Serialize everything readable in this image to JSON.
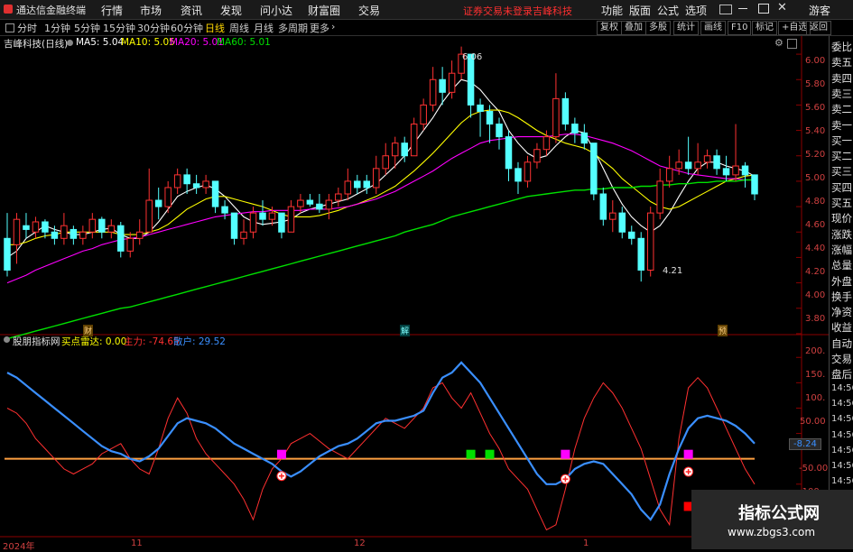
{
  "menubar": {
    "app_title": "通达信金融终端",
    "items": [
      "行情",
      "市场",
      "资讯",
      "发现",
      "问小达",
      "财富圈",
      "交易"
    ],
    "warning": "证券交易未登录",
    "stock_name": "吉峰科技",
    "right_items": [
      "功能",
      "版面",
      "公式",
      "选项"
    ],
    "guest": "游客"
  },
  "periodbar": {
    "tabs": [
      "分时",
      "1分钟",
      "5分钟",
      "15分钟",
      "30分钟",
      "60分钟",
      "日线",
      "周线",
      "月线",
      "多周期",
      "更多"
    ],
    "active": "日线",
    "buttons": [
      "复权",
      "叠加",
      "多股",
      "统计",
      "画线",
      "F10",
      "标记",
      "+自选",
      "返回"
    ]
  },
  "chart_header": {
    "stock": "吉峰科技(日线)",
    "ma5": "MA5: 5.04",
    "ma10": "MA10: 5.05",
    "ma20": "MA20: 5.01",
    "ma60": "MA60: 5.01"
  },
  "indicator_header": {
    "name": "股朋指标网",
    "buy": "买点雷达: 0.00",
    "main": "主力: -74.65",
    "retail": "散户: 29.52"
  },
  "right_panel": [
    "委比",
    "卖五",
    "卖四",
    "卖三",
    "卖二",
    "卖一",
    "买一",
    "买二",
    "买三",
    "买四",
    "买五",
    "现价",
    "涨跌",
    "涨幅",
    "总量",
    "外盘",
    "换手",
    "净资",
    "收益",
    "自动",
    "交易",
    "盘后",
    "14:56",
    "14:56",
    "14:56",
    "14:56",
    "14:56",
    "14:56",
    "14:56"
  ],
  "price_ticks": [
    "6.00",
    "5.80",
    "5.60",
    "5.40",
    "5.20",
    "5.00",
    "4.80",
    "4.60",
    "4.40",
    "4.20",
    "4.00",
    "3.80"
  ],
  "ind_ticks": [
    "200.",
    "150.",
    "100.",
    "50.00",
    "-50.00",
    "-100."
  ],
  "ind_current": "-8.24",
  "price_annotations": {
    "high": "6.06",
    "low": "4.21"
  },
  "markers": {
    "cai": "财",
    "jie": "解",
    "yu": "预"
  },
  "time_axis": [
    "2024年",
    "11",
    "12",
    "1"
  ],
  "watermark": {
    "line1": "指标公式网",
    "line2": "www.zbgs3.com"
  },
  "colors": {
    "up": "#ff3232",
    "down": "#54ffff",
    "ma5": "#ffffff",
    "ma10": "#ffff00",
    "ma20": "#ff00ff",
    "ma60": "#00e000",
    "main": "#3a8fff",
    "retail": "#ff3030",
    "zero": "#ffa040"
  },
  "chart_data": {
    "type": "candlestick",
    "ylim": [
      3.7,
      6.1
    ],
    "candles": [
      [
        4.55,
        4.3,
        4.75,
        4.25
      ],
      [
        4.5,
        4.7,
        4.75,
        4.35
      ],
      [
        4.65,
        4.62,
        4.75,
        4.55
      ],
      [
        4.6,
        4.68,
        4.72,
        4.55
      ],
      [
        4.68,
        4.6,
        4.7,
        4.55
      ],
      [
        4.6,
        4.55,
        4.65,
        4.5
      ],
      [
        4.55,
        4.65,
        4.75,
        4.5
      ],
      [
        4.62,
        4.55,
        4.65,
        4.5
      ],
      [
        4.55,
        4.6,
        4.65,
        4.5
      ],
      [
        4.6,
        4.7,
        4.75,
        4.55
      ],
      [
        4.7,
        4.6,
        4.72,
        4.55
      ],
      [
        4.6,
        4.65,
        4.7,
        4.55
      ],
      [
        4.65,
        4.45,
        4.68,
        4.4
      ],
      [
        4.45,
        4.55,
        4.6,
        4.4
      ],
      [
        4.55,
        4.6,
        4.7,
        4.5
      ],
      [
        4.6,
        4.85,
        5.1,
        4.6
      ],
      [
        4.85,
        4.8,
        4.95,
        4.7
      ],
      [
        4.8,
        4.95,
        5.0,
        4.75
      ],
      [
        4.95,
        5.05,
        5.1,
        4.9
      ],
      [
        5.05,
        4.98,
        5.1,
        4.9
      ],
      [
        4.98,
        4.95,
        5.05,
        4.9
      ],
      [
        4.95,
        5.0,
        5.05,
        4.9
      ],
      [
        5.0,
        4.8,
        5.0,
        4.75
      ],
      [
        4.8,
        4.75,
        4.85,
        4.7
      ],
      [
        4.75,
        4.55,
        4.75,
        4.5
      ],
      [
        4.55,
        4.6,
        4.7,
        4.5
      ],
      [
        4.6,
        4.75,
        4.8,
        4.55
      ],
      [
        4.75,
        4.7,
        4.85,
        4.65
      ],
      [
        4.7,
        4.75,
        4.8,
        4.65
      ],
      [
        4.75,
        4.6,
        4.75,
        4.55
      ],
      [
        4.6,
        4.8,
        4.85,
        4.6
      ],
      [
        4.8,
        4.85,
        4.9,
        4.75
      ],
      [
        4.85,
        4.82,
        4.9,
        4.8
      ],
      [
        4.82,
        4.78,
        4.9,
        4.75
      ],
      [
        4.78,
        4.85,
        4.9,
        4.7
      ],
      [
        4.85,
        4.9,
        4.95,
        4.8
      ],
      [
        4.9,
        5.0,
        5.1,
        4.85
      ],
      [
        5.0,
        4.95,
        5.05,
        4.9
      ],
      [
        5.0,
        4.95,
        5.05,
        4.9
      ],
      [
        4.95,
        5.1,
        5.2,
        4.9
      ],
      [
        5.1,
        5.2,
        5.3,
        5.05
      ],
      [
        5.2,
        5.3,
        5.35,
        5.1
      ],
      [
        5.3,
        5.2,
        5.35,
        5.15
      ],
      [
        5.2,
        5.45,
        5.5,
        5.2
      ],
      [
        5.45,
        5.6,
        5.65,
        5.4
      ],
      [
        5.6,
        5.8,
        5.9,
        5.55
      ],
      [
        5.8,
        5.7,
        5.9,
        5.6
      ],
      [
        5.7,
        5.85,
        5.95,
        5.65
      ],
      [
        5.85,
        6.0,
        6.06,
        5.8
      ],
      [
        6.0,
        5.6,
        6.0,
        5.5
      ],
      [
        5.6,
        5.55,
        5.65,
        5.35
      ],
      [
        5.55,
        5.45,
        5.6,
        5.3
      ],
      [
        5.45,
        5.35,
        5.5,
        5.25
      ],
      [
        5.35,
        5.1,
        5.4,
        5.0
      ],
      [
        5.1,
        5.0,
        5.15,
        4.9
      ],
      [
        5.0,
        5.15,
        5.2,
        4.95
      ],
      [
        5.15,
        5.25,
        5.3,
        5.1
      ],
      [
        5.25,
        5.35,
        5.4,
        5.2
      ],
      [
        5.35,
        5.65,
        5.85,
        5.3
      ],
      [
        5.65,
        5.45,
        5.7,
        5.4
      ],
      [
        5.45,
        5.38,
        5.5,
        5.3
      ],
      [
        5.38,
        5.3,
        5.45,
        5.25
      ],
      [
        5.3,
        4.9,
        5.3,
        4.85
      ],
      [
        4.9,
        4.7,
        4.95,
        4.65
      ],
      [
        4.7,
        4.75,
        4.85,
        4.6
      ],
      [
        4.75,
        4.6,
        4.8,
        4.55
      ],
      [
        4.6,
        4.55,
        4.65,
        4.5
      ],
      [
        4.55,
        4.3,
        4.6,
        4.21
      ],
      [
        4.3,
        4.75,
        4.8,
        4.25
      ],
      [
        4.75,
        5.0,
        5.1,
        4.7
      ],
      [
        5.0,
        5.1,
        5.2,
        4.95
      ],
      [
        5.1,
        5.15,
        5.25,
        5.05
      ],
      [
        5.15,
        5.1,
        5.35,
        5.05
      ],
      [
        5.1,
        5.15,
        5.3,
        5.05
      ],
      [
        5.15,
        5.2,
        5.25,
        5.1
      ],
      [
        5.2,
        5.1,
        5.25,
        5.05
      ],
      [
        5.1,
        5.05,
        5.2,
        5.0
      ],
      [
        5.05,
        5.12,
        5.45,
        5.0
      ],
      [
        5.12,
        5.05,
        5.15,
        4.95
      ],
      [
        5.05,
        4.9,
        5.05,
        4.85
      ]
    ],
    "series": [
      {
        "name": "MA5",
        "values": [
          4.4,
          4.45,
          4.55,
          4.6,
          4.65,
          4.62,
          4.6,
          4.58,
          4.58,
          4.6,
          4.62,
          4.63,
          4.58,
          4.55,
          4.55,
          4.6,
          4.68,
          4.78,
          4.88,
          4.92,
          4.95,
          4.97,
          4.94,
          4.88,
          4.8,
          4.72,
          4.68,
          4.66,
          4.67,
          4.68,
          4.7,
          4.75,
          4.78,
          4.8,
          4.82,
          4.84,
          4.86,
          4.9,
          4.94,
          4.98,
          5.05,
          5.12,
          5.2,
          5.3,
          5.4,
          5.5,
          5.62,
          5.72,
          5.8,
          5.78,
          5.72,
          5.63,
          5.55,
          5.4,
          5.3,
          5.22,
          5.18,
          5.2,
          5.28,
          5.35,
          5.4,
          5.38,
          5.25,
          5.1,
          4.95,
          4.82,
          4.72,
          4.65,
          4.6,
          4.65,
          4.75,
          4.88,
          5.0,
          5.1,
          5.15,
          5.15,
          5.12,
          5.1,
          5.08,
          5.04
        ]
      },
      {
        "name": "MA10",
        "values": [
          4.5,
          4.5,
          4.52,
          4.55,
          4.57,
          4.58,
          4.6,
          4.6,
          4.6,
          4.6,
          4.6,
          4.6,
          4.58,
          4.58,
          4.58,
          4.6,
          4.62,
          4.66,
          4.72,
          4.78,
          4.82,
          4.86,
          4.88,
          4.88,
          4.86,
          4.84,
          4.82,
          4.8,
          4.77,
          4.74,
          4.72,
          4.72,
          4.72,
          4.73,
          4.75,
          4.77,
          4.8,
          4.82,
          4.85,
          4.88,
          4.92,
          4.96,
          5.02,
          5.08,
          5.15,
          5.22,
          5.3,
          5.38,
          5.46,
          5.52,
          5.55,
          5.56,
          5.56,
          5.54,
          5.5,
          5.45,
          5.4,
          5.36,
          5.33,
          5.3,
          5.28,
          5.26,
          5.22,
          5.16,
          5.1,
          5.02,
          4.96,
          4.9,
          4.84,
          4.8,
          4.78,
          4.8,
          4.84,
          4.88,
          4.92,
          4.96,
          5.0,
          5.02,
          5.04,
          5.05
        ]
      },
      {
        "name": "MA20",
        "values": [
          4.2,
          4.23,
          4.26,
          4.3,
          4.33,
          4.36,
          4.39,
          4.42,
          4.45,
          4.47,
          4.5,
          4.52,
          4.54,
          4.55,
          4.56,
          4.58,
          4.6,
          4.62,
          4.64,
          4.66,
          4.68,
          4.7,
          4.72,
          4.73,
          4.74,
          4.75,
          4.76,
          4.76,
          4.77,
          4.77,
          4.77,
          4.77,
          4.78,
          4.78,
          4.78,
          4.79,
          4.8,
          4.82,
          4.84,
          4.86,
          4.89,
          4.92,
          4.96,
          5.0,
          5.04,
          5.08,
          5.13,
          5.18,
          5.22,
          5.26,
          5.3,
          5.32,
          5.33,
          5.34,
          5.35,
          5.35,
          5.35,
          5.35,
          5.36,
          5.37,
          5.37,
          5.36,
          5.34,
          5.32,
          5.3,
          5.27,
          5.24,
          5.2,
          5.16,
          5.12,
          5.1,
          5.08,
          5.06,
          5.05,
          5.04,
          5.03,
          5.02,
          5.02,
          5.01,
          5.01
        ]
      },
      {
        "name": "MA60",
        "values": [
          3.76,
          3.78,
          3.8,
          3.82,
          3.84,
          3.86,
          3.88,
          3.9,
          3.92,
          3.94,
          3.96,
          3.98,
          4.0,
          4.01,
          4.03,
          4.05,
          4.07,
          4.09,
          4.11,
          4.13,
          4.15,
          4.17,
          4.19,
          4.21,
          4.23,
          4.25,
          4.27,
          4.29,
          4.31,
          4.33,
          4.35,
          4.37,
          4.39,
          4.41,
          4.43,
          4.45,
          4.47,
          4.49,
          4.51,
          4.53,
          4.55,
          4.57,
          4.6,
          4.62,
          4.64,
          4.66,
          4.69,
          4.72,
          4.74,
          4.76,
          4.78,
          4.8,
          4.82,
          4.84,
          4.86,
          4.88,
          4.89,
          4.9,
          4.91,
          4.92,
          4.93,
          4.93,
          4.94,
          4.94,
          4.95,
          4.95,
          4.95,
          4.96,
          4.96,
          4.97,
          4.97,
          4.98,
          4.98,
          4.99,
          4.99,
          5.0,
          5.0,
          5.0,
          5.01,
          5.01
        ]
      }
    ],
    "indicator": {
      "ylim": [
        -150,
        220
      ],
      "main": [
        170,
        160,
        145,
        130,
        115,
        100,
        85,
        70,
        55,
        40,
        25,
        15,
        10,
        0,
        -5,
        5,
        20,
        45,
        70,
        80,
        75,
        70,
        60,
        45,
        30,
        20,
        10,
        0,
        -10,
        -25,
        -35,
        -25,
        -10,
        5,
        15,
        25,
        30,
        40,
        55,
        70,
        75,
        75,
        80,
        85,
        95,
        130,
        160,
        170,
        190,
        170,
        150,
        120,
        90,
        60,
        30,
        0,
        -30,
        -50,
        -50,
        -40,
        -20,
        -10,
        -5,
        -10,
        -30,
        -50,
        -70,
        -100,
        -120,
        -90,
        -30,
        20,
        60,
        80,
        85,
        80,
        75,
        65,
        50,
        30
      ],
      "retail": [
        100,
        90,
        70,
        40,
        20,
        0,
        -20,
        -30,
        -20,
        -10,
        10,
        20,
        30,
        0,
        -20,
        -30,
        20,
        80,
        120,
        90,
        40,
        10,
        -10,
        -30,
        -50,
        -80,
        -120,
        -60,
        -20,
        0,
        30,
        40,
        50,
        35,
        20,
        10,
        0,
        20,
        40,
        60,
        80,
        70,
        60,
        80,
        100,
        140,
        150,
        120,
        100,
        130,
        90,
        50,
        20,
        -20,
        -40,
        -60,
        -100,
        -140,
        -130,
        -60,
        20,
        80,
        120,
        150,
        130,
        100,
        60,
        20,
        -40,
        -100,
        -130,
        40,
        140,
        160,
        140,
        100,
        60,
        20,
        -20,
        -50
      ]
    }
  }
}
